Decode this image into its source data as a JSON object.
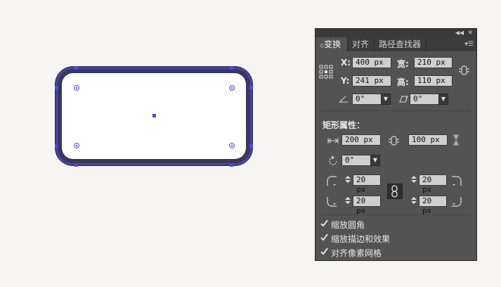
{
  "panel": {
    "tabs": [
      "变换",
      "对齐",
      "路径查找器"
    ],
    "active_tab": 0,
    "transform": {
      "x_label": "X:",
      "x_value": "400 px",
      "y_label": "Y:",
      "y_value": "241 px",
      "width_label": "宽:",
      "width_value": "210 px",
      "height_label": "高:",
      "height_value": "110 px",
      "rotate_value": "0°",
      "shear_value": "0°"
    },
    "rect_props": {
      "title": "矩形属性：",
      "width_value": "200 px",
      "height_value": "100 px",
      "angle_value": "0°",
      "corner_tl": "20 px",
      "corner_tr": "20 px",
      "corner_bl": "20 px",
      "corner_br": "20 px"
    },
    "options": [
      {
        "label": "缩放圆角",
        "checked": true
      },
      {
        "label": "缩放描边和效果",
        "checked": true
      },
      {
        "label": "对齐像素网格",
        "checked": true
      }
    ]
  },
  "colors": {
    "shape_stroke": "#3b3758",
    "selection": "#4a4af0",
    "panel_bg": "#535353"
  }
}
